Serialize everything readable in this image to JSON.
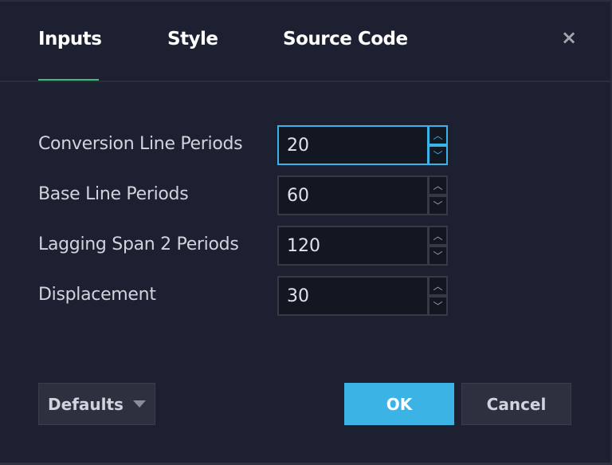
{
  "tabs": [
    {
      "label": "Inputs",
      "active": true
    },
    {
      "label": "Style"
    },
    {
      "label": "Source Code"
    }
  ],
  "close_icon": "×",
  "accent_tab": "#3cbf7c",
  "fields": [
    {
      "label": "Conversion Line Periods",
      "value": "20",
      "focused": true
    },
    {
      "label": "Base Line Periods",
      "value": "60"
    },
    {
      "label": "Lagging Span 2 Periods",
      "value": "120"
    },
    {
      "label": "Displacement",
      "value": "30"
    }
  ],
  "spinner": {
    "up": "︿",
    "down": "﹀"
  },
  "footer": {
    "defaults_label": "Defaults",
    "ok_label": "OK",
    "cancel_label": "Cancel",
    "ok_color": "#3bb3e4"
  }
}
